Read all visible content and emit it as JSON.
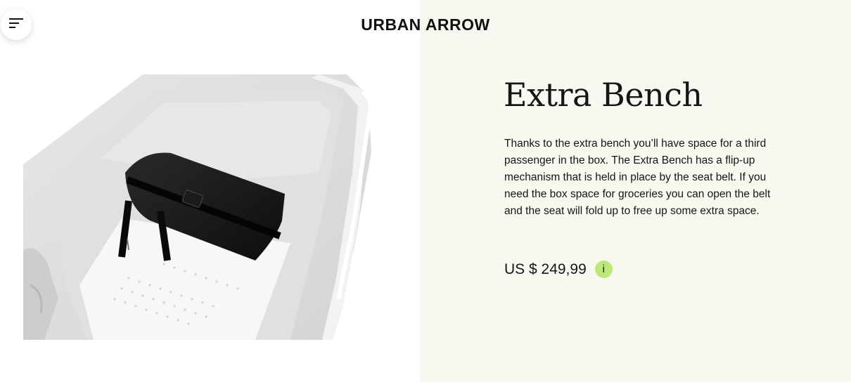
{
  "header": {
    "logo_text": "URBAN ARROW",
    "menu_icon": "hamburger-menu-icon"
  },
  "product": {
    "title": "Extra Bench",
    "description": "Thanks to the extra bench you’ll have space for a third passenger in the box. The Extra Bench has a flip-up mechanism that is held in place by the seat belt. If you need the box space for groceries you can open the belt and the seat will fold up to free up some extra space.",
    "price": "US $ 249,99",
    "info_label": "i",
    "info_icon": "info-icon"
  },
  "colors": {
    "right_panel_bg": "#f8f7f0",
    "info_accent": "#bce87a",
    "text": "#161616"
  }
}
